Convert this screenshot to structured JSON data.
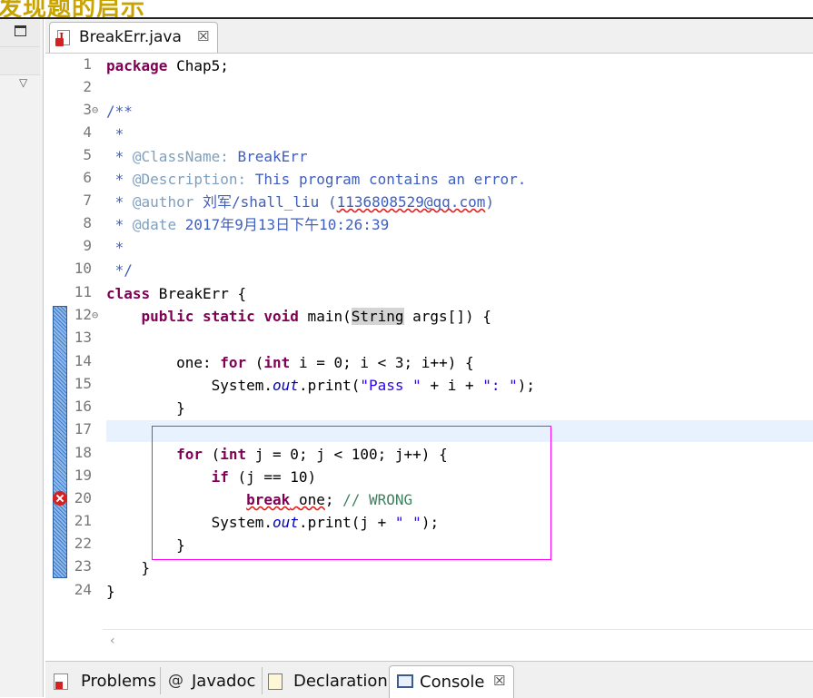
{
  "banner": {
    "text": "发现题的启示"
  },
  "editor_tab": {
    "label": "BreakErr.java",
    "close": "☒"
  },
  "panel_tabs": [
    {
      "label": "Problems",
      "icon": "problems-icon"
    },
    {
      "label": "Javadoc",
      "icon": "at-icon"
    },
    {
      "label": "Declaration",
      "icon": "declaration-icon"
    },
    {
      "label": "Console",
      "icon": "console-icon",
      "close": "☒"
    }
  ],
  "line_numbers": [
    "1",
    "2",
    "3",
    "4",
    "5",
    "6",
    "7",
    "8",
    "9",
    "10",
    "11",
    "12",
    "13",
    "14",
    "15",
    "16",
    "17",
    "18",
    "19",
    "20",
    "21",
    "22",
    "23",
    "24"
  ],
  "code": {
    "l1_kw": "package",
    "l1_rest": " Chap5;",
    "l3": "/**",
    "l4": " *",
    "l5_a": " * ",
    "l5_b": "@ClassName:",
    "l5_c": " BreakErr",
    "l6_a": " * ",
    "l6_b": "@Description:",
    "l6_c": " This program contains an error.",
    "l7_a": " * ",
    "l7_b": "@author",
    "l7_c": " 刘军/shall_liu (",
    "l7_d": "1136808529@qq.com",
    "l7_e": ")",
    "l8_a": " * ",
    "l8_b": "@date",
    "l8_c": " 2017年9月13日下午10:26:39",
    "l9": " *",
    "l10": " */",
    "l11_kw": "class",
    "l11_rest": " BreakErr {",
    "l12_kw": "    public static void",
    "l12_a": " main(",
    "l12_hl": "String",
    "l12_b": " args[]) {",
    "l14_a": "        one: ",
    "l14_kw1": "for",
    "l14_b": " (",
    "l14_kw2": "int",
    "l14_c": " i = 0; i < 3; i++) {",
    "l15_a": "            System.",
    "l15_fld": "out",
    "l15_b": ".print(",
    "l15_s1": "\"Pass \"",
    "l15_c": " + i + ",
    "l15_s2": "\": \"",
    "l15_d": ");",
    "l16": "        }",
    "l18_a": "        ",
    "l18_kw1": "for",
    "l18_b": " (",
    "l18_kw2": "int",
    "l18_c": " j = 0; j < 100; j++) {",
    "l19_a": "            ",
    "l19_kw": "if",
    "l19_b": " (j == 10)",
    "l20_a": "                ",
    "l20_kw": "break",
    "l20_sp": " ",
    "l20_one": "one",
    "l20_semi": ";",
    "l20_cm": " // WRONG",
    "l21_a": "            System.",
    "l21_fld": "out",
    "l21_b": ".print(j + ",
    "l21_s": "\" \"",
    "l21_c": ");",
    "l22": "        }",
    "l23": "    }",
    "l24": "}"
  },
  "colors": {
    "keyword": "#7f0055",
    "comment": "#3f5fbf",
    "string": "#2a00ff",
    "field": "#0000c0",
    "selection_box": "#ff00ff",
    "error": "#d42121"
  }
}
